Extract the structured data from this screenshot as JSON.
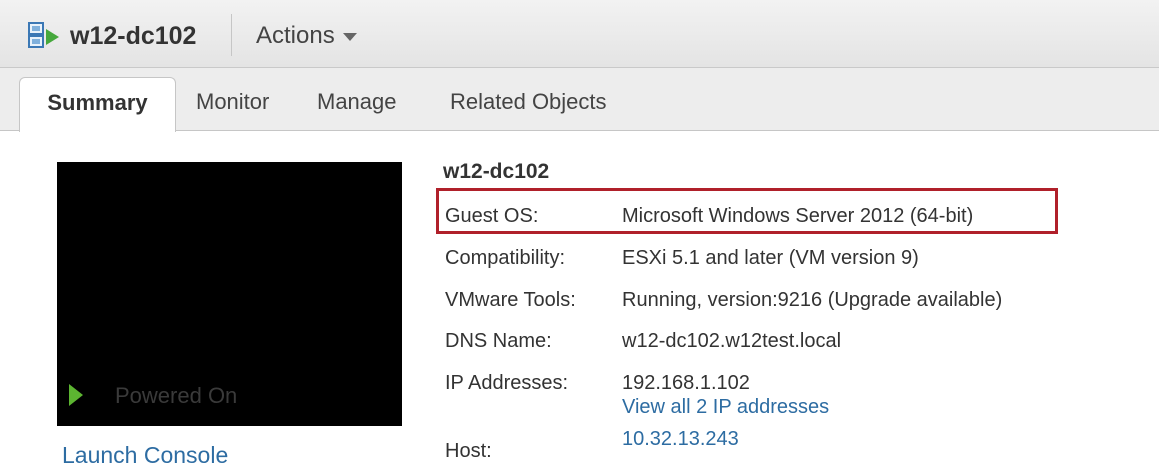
{
  "header": {
    "vm_name": "w12-dc102",
    "actions_label": "Actions",
    "vm_icon": "vm-powered-on-icon",
    "actions_icon": "caret-down-icon"
  },
  "tabs": [
    {
      "label": "Summary",
      "active": true
    },
    {
      "label": "Monitor",
      "active": false
    },
    {
      "label": "Manage",
      "active": false
    },
    {
      "label": "Related Objects",
      "active": false
    }
  ],
  "console": {
    "status_text": "Powered On",
    "status_icon": "play-icon",
    "launch_label": "Launch Console"
  },
  "details": {
    "title": "w12-dc102",
    "guest_os_label": "Guest OS:",
    "guest_os_value": "Microsoft Windows Server 2012 (64-bit)",
    "compatibility_label": "Compatibility:",
    "compatibility_value": "ESXi 5.1 and later (VM version 9)",
    "tools_label": "VMware Tools:",
    "tools_value": "Running, version:9216 (Upgrade available)",
    "dns_label": "DNS Name:",
    "dns_value": "w12-dc102.w12test.local",
    "ip_label": "IP Addresses:",
    "ip_value": "192.168.1.102",
    "ip_link": "View all 2 IP addresses",
    "host_label": "Host:",
    "host_value": "10.32.13.243"
  },
  "colors": {
    "link": "#2d6ca2",
    "highlight_border": "#b0202a",
    "play_green": "#5cb531"
  }
}
